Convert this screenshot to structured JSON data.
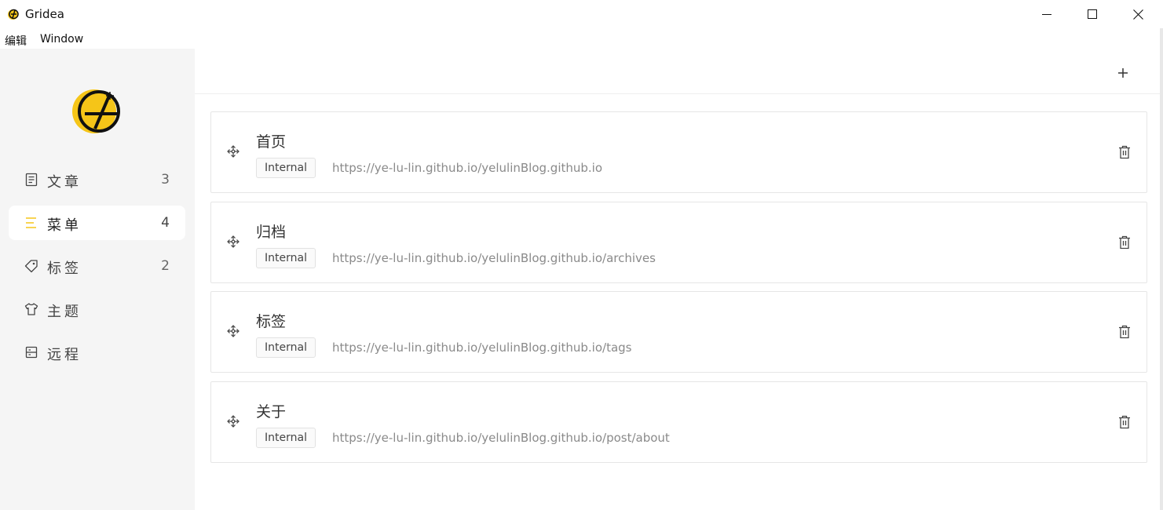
{
  "window": {
    "title": "Gridea",
    "minimize_icon": "minimize-icon",
    "maximize_icon": "maximize-icon",
    "close_icon": "close-icon"
  },
  "menubar": {
    "items": [
      {
        "label": "编辑"
      },
      {
        "label": "Window"
      }
    ]
  },
  "sidebar": {
    "logo_icon": "gridea-logo",
    "items": [
      {
        "label": "文章",
        "count": "3",
        "icon": "article-icon",
        "active": false
      },
      {
        "label": "菜单",
        "count": "4",
        "icon": "menu-icon",
        "active": true
      },
      {
        "label": "标签",
        "count": "2",
        "icon": "tag-icon",
        "active": false
      },
      {
        "label": "主题",
        "count": "",
        "icon": "theme-icon",
        "active": false
      },
      {
        "label": "远程",
        "count": "",
        "icon": "remote-icon",
        "active": false
      }
    ]
  },
  "toolbar": {
    "add_icon": "plus-icon"
  },
  "menus": [
    {
      "name": "首页",
      "type": "Internal",
      "link": "https://ye-lu-lin.github.io/yelulinBlog.github.io"
    },
    {
      "name": "归档",
      "type": "Internal",
      "link": "https://ye-lu-lin.github.io/yelulinBlog.github.io/archives"
    },
    {
      "name": "标签",
      "type": "Internal",
      "link": "https://ye-lu-lin.github.io/yelulinBlog.github.io/tags"
    },
    {
      "name": "关于",
      "type": "Internal",
      "link": "https://ye-lu-lin.github.io/yelulinBlog.github.io/post/about"
    }
  ],
  "colors": {
    "accent": "#f5c518",
    "sidebar_bg": "#f5f5f5",
    "active_bg": "#ffffff"
  }
}
